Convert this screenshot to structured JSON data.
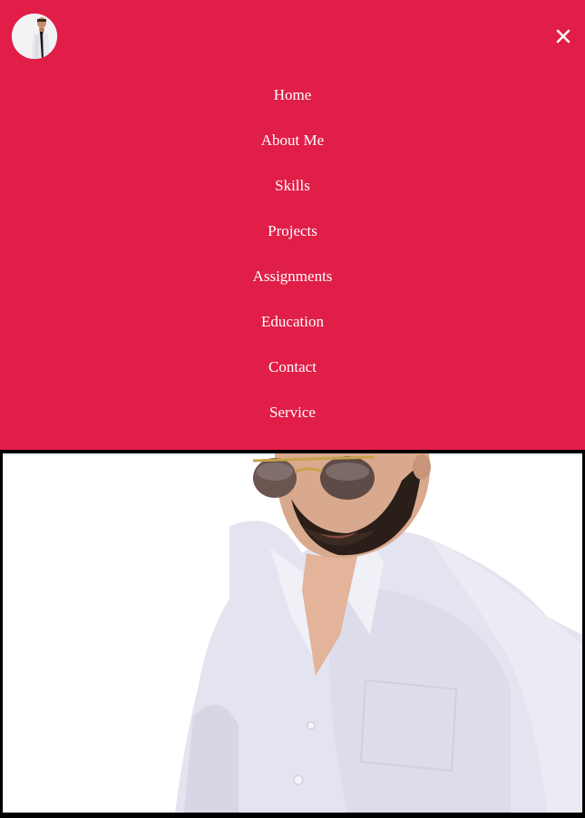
{
  "header": {
    "logo_alt": "Profile avatar",
    "close_icon": "close-icon"
  },
  "nav": {
    "items": [
      {
        "label": "Home"
      },
      {
        "label": "About Me"
      },
      {
        "label": "Skills"
      },
      {
        "label": "Projects"
      },
      {
        "label": "Assignments"
      },
      {
        "label": "Education"
      },
      {
        "label": "Contact"
      },
      {
        "label": "Service"
      }
    ]
  },
  "hero": {
    "image_alt": "Portrait photo of a man with sunglasses and white shirt"
  },
  "colors": {
    "menu_bg": "#e01e48",
    "menu_text": "#ffffff",
    "frame": "#000000"
  }
}
